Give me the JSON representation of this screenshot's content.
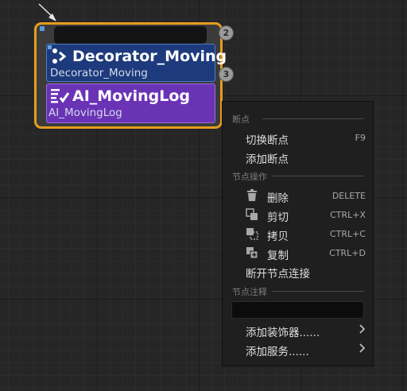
{
  "node": {
    "top_badge": "2",
    "side_badge": "3",
    "decorator": {
      "title": "Decorator_Moving",
      "subtitle": "Decorator_Moving",
      "icon": "decorator-icon"
    },
    "task": {
      "title": "AI_MovingLog",
      "subtitle": "AI_MovingLog",
      "icon": "task-icon"
    }
  },
  "context_menu": {
    "sections": {
      "breakpoints": "断点",
      "node_actions": "节点操作",
      "node_comment": "节点注释"
    },
    "items": {
      "toggle_breakpoint": {
        "label": "切换断点",
        "shortcut": "F9"
      },
      "add_breakpoint": {
        "label": "添加断点"
      },
      "delete": {
        "label": "删除",
        "shortcut": "DELETE",
        "icon": "trash-icon"
      },
      "cut": {
        "label": "剪切",
        "shortcut": "CTRL+X",
        "icon": "cut-icon"
      },
      "copy": {
        "label": "拷贝",
        "shortcut": "CTRL+C",
        "icon": "copy-icon"
      },
      "duplicate": {
        "label": "复制",
        "shortcut": "CTRL+D",
        "icon": "duplicate-icon"
      },
      "break_links": {
        "label": "断开节点连接"
      },
      "add_decorator": {
        "label": "添加装饰器......",
        "icon": "chevron-right-icon"
      },
      "add_service": {
        "label": "添加服务......",
        "icon": "chevron-right-icon"
      }
    },
    "comment_value": ""
  },
  "colors": {
    "canvas": "#262626",
    "node_outline": "#e69c1e",
    "decorator": "#1d3a7c",
    "task": "#6a33b6",
    "menu_bg": "#1f1f1f"
  }
}
